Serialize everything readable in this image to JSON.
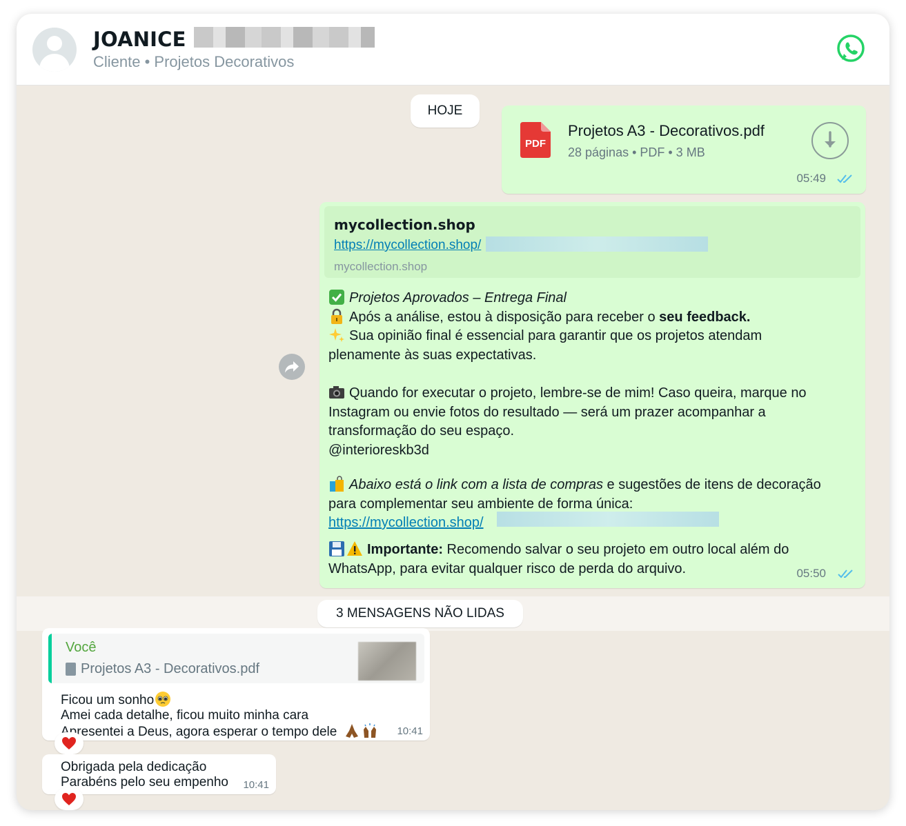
{
  "header": {
    "contact_name": "JOANICE S",
    "subtitle": "Cliente • Projetos Decorativos",
    "app_icon": "whatsapp-icon"
  },
  "chat": {
    "date_divider": "HOJE",
    "document_message": {
      "icon": "pdf-icon",
      "icon_label": "PDF",
      "file_name": "Projetos A3 - Decorativos.pdf",
      "meta": "28 páginas • PDF • 3 MB",
      "time": "05:49",
      "status": "read"
    },
    "long_message": {
      "link_preview": {
        "title": "mycollection.shop",
        "url": "https://mycollection.shop/",
        "domain": "mycollection.shop"
      },
      "lines": {
        "l1": "Projetos Aprovados – Entrega Final",
        "l2a": "Após a análise, estou à disposição para receber o ",
        "l2b": "seu feedback.",
        "l3": "Sua opinião final é essencial para garantir que os projetos atendam",
        "l4": "plenamente às suas expectativas.",
        "l5": "Quando for executar o projeto, lembre-se de mim! Caso queira, marque no",
        "l6": "Instagram ou envie fotos do resultado — será um prazer acompanhar a",
        "l7": "transformação do seu espaço.",
        "l8": "@interioreskb3d",
        "l9a": "Abaixo está o link com a lista de compras",
        "l9b": " e sugestões de itens de decoração",
        "l10": "para complementar seu ambiente de forma única:",
        "l11": "https://mycollection.shop/",
        "l12a": "Importante:",
        "l12b": " Recomendo salvar o seu projeto em outro local além do",
        "l13": "WhatsApp, para evitar qualquer risco de perda do arquivo."
      },
      "time": "05:50",
      "status": "read"
    },
    "unread_divider": "3 MENSAGENS NÃO LIDAS",
    "incoming_1": {
      "quote_author": "Você",
      "quote_file": "Projetos A3 - Decorativos.pdf",
      "line1": "Ficou um sonho",
      "line2": "Amei cada detalhe, ficou muito minha cara",
      "line3": "Apresentei a Deus, agora esperar o tempo dele",
      "time": "10:41",
      "reaction": "heart-icon"
    },
    "incoming_2": {
      "line1": "Obrigada pela dedicação",
      "line2": "Parabéns pelo seu empenho",
      "time": "10:41",
      "reaction": "heart-icon"
    }
  },
  "colors": {
    "outgoing_bubble": "#d9fdd3",
    "incoming_bubble": "#ffffff",
    "chat_background": "#efeae2",
    "link": "#027eb5",
    "read_ticks": "#53bdeb",
    "whatsapp_green": "#25d366",
    "quote_author": "#53a63e"
  }
}
